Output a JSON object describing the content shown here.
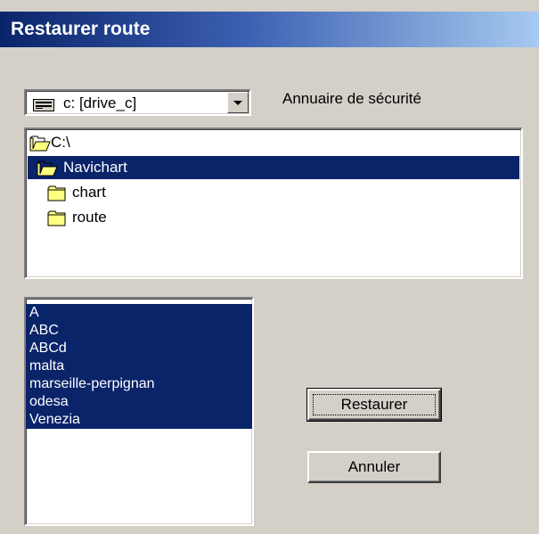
{
  "window": {
    "title": "Restaurer route"
  },
  "drive_select": {
    "value": "c: [drive_c]"
  },
  "security_label": "Annuaire de sécurité",
  "directory_tree": [
    {
      "label": "C:\\",
      "icon": "open-folder-icon",
      "selected": false
    },
    {
      "label": "Navichart",
      "icon": "open-folder-icon",
      "selected": true
    },
    {
      "label": "chart",
      "icon": "folder-icon",
      "selected": false
    },
    {
      "label": "route",
      "icon": "folder-icon",
      "selected": false
    }
  ],
  "route_files": [
    "A",
    "ABC",
    "ABCd",
    "malta",
    "marseille-perpignan",
    "odesa",
    "Venezia"
  ],
  "buttons": {
    "restore": "Restaurer",
    "cancel": "Annuler"
  },
  "colors": {
    "selection": "#0a246a",
    "titlebar_start": "#0a246a",
    "titlebar_end": "#a6caf0",
    "face": "#d4d0c8"
  }
}
